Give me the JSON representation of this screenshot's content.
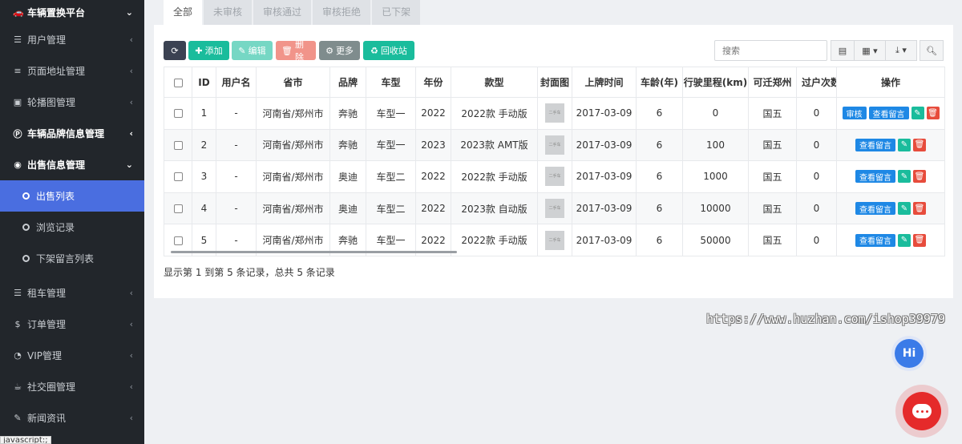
{
  "sidebar": {
    "items": [
      {
        "label": "车辆置换平台",
        "icon": "car-icon",
        "caret": "⌄"
      },
      {
        "label": "用户管理",
        "icon": "list-icon",
        "caret": "‹"
      },
      {
        "label": "页面地址管理",
        "icon": "menu-icon",
        "caret": "‹"
      },
      {
        "label": "轮播图管理",
        "icon": "image-icon",
        "caret": "‹"
      },
      {
        "label": "车辆品牌信息管理",
        "icon": "parking-icon",
        "caret": "‹"
      },
      {
        "label": "出售信息管理",
        "icon": "eye-icon",
        "caret": "⌄"
      },
      {
        "label": "出售列表"
      },
      {
        "label": "浏览记录"
      },
      {
        "label": "下架留言列表"
      },
      {
        "label": "租车管理",
        "icon": "list-icon",
        "caret": "‹"
      },
      {
        "label": "订单管理",
        "icon": "dollar-icon",
        "caret": "‹"
      },
      {
        "label": "VIP管理",
        "icon": "user-circle-icon",
        "caret": "‹"
      },
      {
        "label": "社交圈管理",
        "icon": "coffee-icon",
        "caret": "‹"
      },
      {
        "label": "新闻资讯",
        "icon": "edit-icon",
        "caret": "‹"
      }
    ],
    "status_tip": "javascript:;"
  },
  "tabs": [
    "全部",
    "未审核",
    "审核通过",
    "审核拒绝",
    "已下架"
  ],
  "toolbar": {
    "add": "添加",
    "edit": "编辑",
    "delete": "删除",
    "more": "更多",
    "recycle": "回收站",
    "search_placeholder": "搜索"
  },
  "table": {
    "headers": [
      "ID",
      "用户名",
      "省市",
      "品牌",
      "车型",
      "年份",
      "款型",
      "封面图",
      "上牌时间",
      "车龄(年)",
      "行驶里程(km)",
      "可迁郑州",
      "过户次数",
      "操作"
    ],
    "rows": [
      {
        "id": "1",
        "user": "-",
        "city": "河南省/郑州市",
        "brand": "奔驰",
        "model": "车型一",
        "year": "2022",
        "style": "2022款 手动版",
        "reg": "2017-03-09",
        "age": "6",
        "km": "0",
        "std": "国五",
        "transfers": "0",
        "review": true
      },
      {
        "id": "2",
        "user": "-",
        "city": "河南省/郑州市",
        "brand": "奔驰",
        "model": "车型一",
        "year": "2023",
        "style": "2023款 AMT版",
        "reg": "2017-03-09",
        "age": "6",
        "km": "100",
        "std": "国五",
        "transfers": "0",
        "review": false
      },
      {
        "id": "3",
        "user": "-",
        "city": "河南省/郑州市",
        "brand": "奥迪",
        "model": "车型二",
        "year": "2022",
        "style": "2022款 手动版",
        "reg": "2017-03-09",
        "age": "6",
        "km": "1000",
        "std": "国五",
        "transfers": "0",
        "review": false
      },
      {
        "id": "4",
        "user": "-",
        "city": "河南省/郑州市",
        "brand": "奥迪",
        "model": "车型二",
        "year": "2022",
        "style": "2023款 自动版",
        "reg": "2017-03-09",
        "age": "6",
        "km": "10000",
        "std": "国五",
        "transfers": "0",
        "review": false
      },
      {
        "id": "5",
        "user": "-",
        "city": "河南省/郑州市",
        "brand": "奔驰",
        "model": "车型一",
        "year": "2022",
        "style": "2022款 手动版",
        "reg": "2017-03-09",
        "age": "6",
        "km": "50000",
        "std": "国五",
        "transfers": "0",
        "review": false
      }
    ],
    "op_review": "审核",
    "op_view": "查看留言",
    "thumb_text": "二手车"
  },
  "footer": "显示第 1 到第 5 条记录，总共 5 条记录",
  "watermark": "https://www.huzhan.com/ishop39979",
  "hi_label": "Hi"
}
